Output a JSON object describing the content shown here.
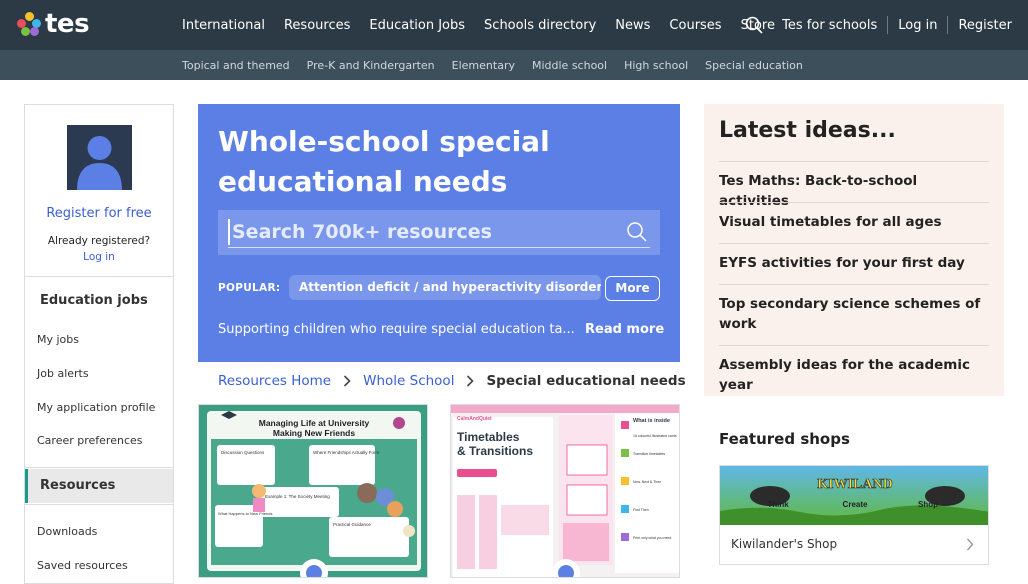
{
  "header": {
    "logo_text": "tes",
    "nav": [
      "International",
      "Resources",
      "Education Jobs",
      "Schools directory",
      "News",
      "Courses",
      "Store"
    ],
    "right_links": [
      "Tes for schools",
      "Log in",
      "Register"
    ],
    "subnav": [
      "Topical and themed",
      "Pre-K and Kindergarten",
      "Elementary",
      "Middle school",
      "High school",
      "Special education"
    ]
  },
  "sidebar": {
    "register_label": "Register for free",
    "already_label": "Already registered?",
    "login_label": "Log in",
    "jobs_heading": "Education jobs",
    "jobs_items": [
      "My jobs",
      "Job alerts",
      "My application profile",
      "Career preferences"
    ],
    "resources_heading": "Resources",
    "resources_items": [
      "Downloads",
      "Saved resources"
    ]
  },
  "hero": {
    "title": "Whole-school special educational needs resources",
    "search_placeholder": "Search 700k+ resources",
    "popular_label": "POPULAR:",
    "popular_chip": "Attention deficit / and hyperactivity disorder (...",
    "more_label": "More",
    "description": "Supporting children who require special education ta...",
    "read_more": "Read more"
  },
  "breadcrumb": {
    "items": [
      "Resources Home",
      "Whole School"
    ],
    "current": "Special educational needs"
  },
  "cards": [
    {
      "title_line1": "Managing Life at University",
      "title_line2": "Making New Friends",
      "panels": [
        "Discussion Questions",
        "Where Friendships Actually Form",
        "Example 1: The Society Meeting",
        "What Happens to New Friends",
        "Practical Guidance"
      ]
    },
    {
      "brand": "CalmAndQuiet",
      "title_line1": "Timetables",
      "title_line2": "& Transitions",
      "subtitle": "What is inside",
      "side_items": [
        "16 colourful illustrated cards",
        "Transition timetables",
        "Now, Next & Then",
        "First Then",
        "Print only what you need"
      ]
    }
  ],
  "ideas": {
    "title": "Latest ideas...",
    "items": [
      "Tes Maths: Back-to-school activities",
      "Visual timetables for all ages",
      "EYFS activities for your first day",
      "Top secondary science schemes of work",
      "Assembly ideas for the academic year"
    ]
  },
  "featured": {
    "title": "Featured shops",
    "shop_name": "Kiwilander's Shop",
    "banner_title": "KIWILAND",
    "banner_words": [
      "Think",
      "Create",
      "Shop"
    ]
  },
  "colors": {
    "header_bg": "#2b3a44",
    "subnav_bg": "#3d4f5b",
    "hero_bg": "#5c7fe6",
    "link_blue": "#3a5fd1",
    "accent_teal": "#1a9a8a",
    "ideas_bg": "#fbf1ec"
  }
}
